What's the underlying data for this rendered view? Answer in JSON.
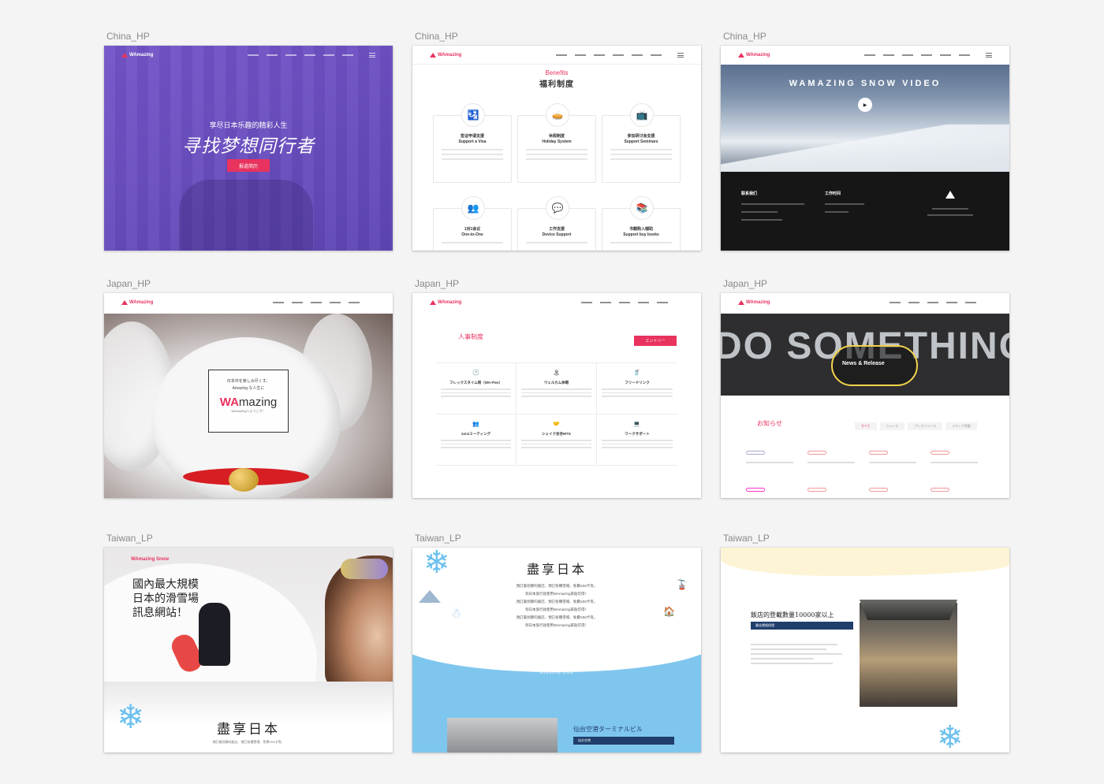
{
  "cards": [
    {
      "label": "China_HP"
    },
    {
      "label": "China_HP"
    },
    {
      "label": "China_HP"
    },
    {
      "label": "Japan_HP"
    },
    {
      "label": "Japan_HP"
    },
    {
      "label": "Japan_HP"
    },
    {
      "label": "Taiwan_LP"
    },
    {
      "label": "Taiwan_LP"
    },
    {
      "label": "Taiwan_LP"
    }
  ],
  "china_hero": {
    "subtitle": "享尽日本乐趣的精彩人生",
    "title": "寻找梦想同行者",
    "button": "报道简历"
  },
  "china_benefits": {
    "title_en": "Benefits",
    "title_jp": "福利制度",
    "items": [
      {
        "jp": "签证申请支援",
        "en": "Support a Visa",
        "icon": "🛂"
      },
      {
        "jp": "休假制度",
        "en": "Holiday System",
        "icon": "🥧"
      },
      {
        "jp": "参加研讨会支援",
        "en": "Support Seminars",
        "icon": "📺"
      },
      {
        "jp": "1对1会议",
        "en": "One-to-One",
        "icon": "👥"
      },
      {
        "jp": "工作支援",
        "en": "Device Support",
        "icon": "💬"
      },
      {
        "jp": "书籍购入辅助",
        "en": "Support buy books",
        "icon": "📚"
      }
    ]
  },
  "china_video": {
    "title": "WAMAZING SNOW VIDEO",
    "footer_col1": "联系我们",
    "footer_col2": "工作时间"
  },
  "japan_hero": {
    "line1": "日本中を楽しみ尽くす。",
    "line2": "Amazing な人生に",
    "logo_wa": "WA",
    "logo_rest": "mazing",
    "caption": "WAmazingへようこそ！"
  },
  "japan_system": {
    "section": "人事制度",
    "entry": "エントリー",
    "items": [
      {
        "title": "フレックスタイム制（WA-Flex）",
        "icon": "🕐"
      },
      {
        "title": "ウェルカム休暇",
        "icon": "🏝"
      },
      {
        "title": "フリードリンク",
        "icon": "🥤"
      },
      {
        "title": "1on1ミーティング",
        "icon": "👥"
      },
      {
        "title": "シェイク会合MTG",
        "icon": "🤝"
      },
      {
        "title": "ワークサポート",
        "icon": "💻"
      }
    ]
  },
  "japan_news": {
    "hero_text": "DO SOMETHING GREAT",
    "pill": "News & Release",
    "section": "お知らせ",
    "tabs": [
      "すべて",
      "ニュース",
      "プレスリリース",
      "メディア掲載"
    ]
  },
  "taiwan_hero": {
    "brand": "WAmazing Snow",
    "slogan": [
      "國內最大規模",
      "日本的滑雪場",
      "訊息網站！"
    ],
    "title": "盡享日本",
    "fine": "預訂最划算的飯店、預訂各種雪場、免費SIM卡等。"
  },
  "taiwan_snow": {
    "title": "盡享日本",
    "lines": [
      "預訂最划算的飯店、預訂各種雪場、免費SIM卡等。",
      "到日本旅行就使用WAmazing來點可得！",
      "預訂最划算的飯店、預訂各種雪場、免費SIM卡等。",
      "到日本旅行就使用WAmazing來點可得！",
      "預訂最划算的飯店、預訂各種雪場、免費SIM卡等。",
      "到日本旅行就使用WAmazing來點可得！"
    ],
    "watermark": "WAmazing Snow",
    "place": "仙台空港ターミナルビル",
    "place_tag": "仙台空港"
  },
  "taiwan_hotel": {
    "headline": "飯店的登載數量10000家以上",
    "tag": "最佳價格保證"
  }
}
